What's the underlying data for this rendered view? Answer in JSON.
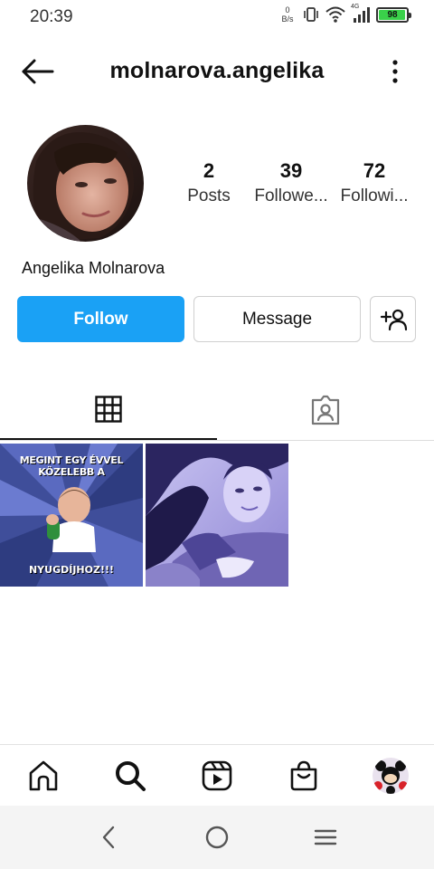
{
  "status_bar": {
    "time": "20:39",
    "net_speed_value": "0",
    "net_speed_unit": "B/s",
    "network_type": "4G",
    "battery_level": 98,
    "battery_color": "#3ad14a",
    "icons": [
      "vibrate-icon",
      "wifi-icon",
      "cell-signal-icon",
      "battery-icon"
    ]
  },
  "header": {
    "username": "molnarova.angelika",
    "back_icon": "arrow-left-icon",
    "more_icon": "more-vertical-icon"
  },
  "profile": {
    "display_name": "Angelika Molnarova",
    "stats": [
      {
        "value": "2",
        "label": "Posts"
      },
      {
        "value": "39",
        "label": "Followe..."
      },
      {
        "value": "72",
        "label": "Followi..."
      }
    ]
  },
  "actions": {
    "follow_label": "Follow",
    "message_label": "Message",
    "add_user_icon": "add-user-icon",
    "accent_color": "#1aa1f5"
  },
  "tabs": [
    {
      "icon": "grid-icon",
      "selected": true
    },
    {
      "icon": "tagged-user-icon",
      "selected": false
    }
  ],
  "posts": [
    {
      "type": "meme",
      "top_text": "MEGINT EGY ÉVVEL KÖZELEBB A",
      "bottom_text": "NYUGDÍJHOZ!!!"
    },
    {
      "type": "photo"
    }
  ],
  "bottom_nav": [
    {
      "icon": "home-icon"
    },
    {
      "icon": "search-icon",
      "selected": true
    },
    {
      "icon": "reels-icon"
    },
    {
      "icon": "shop-icon"
    },
    {
      "icon": "profile-avatar"
    }
  ],
  "system_nav": [
    {
      "icon": "back-chevron-icon"
    },
    {
      "icon": "home-circle-icon"
    },
    {
      "icon": "recents-menu-icon"
    }
  ]
}
